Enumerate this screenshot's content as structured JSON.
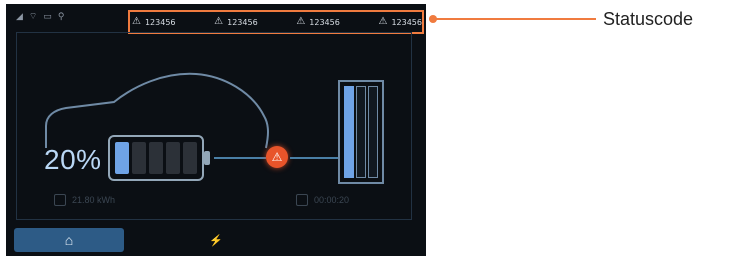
{
  "status_bar": {
    "system_icons": [
      "signal-icon",
      "wifi-icon",
      "display-icon",
      "person-icon"
    ],
    "codes": [
      {
        "icon": "warning-icon",
        "text": "123456"
      },
      {
        "icon": "warning-icon",
        "text": "123456"
      },
      {
        "icon": "warning-icon",
        "text": "123456"
      },
      {
        "icon": "warning-icon",
        "text": "123456"
      }
    ]
  },
  "main": {
    "battery_percent_label": "20%",
    "battery_level_fraction": 0.2,
    "alert_icon": "warning-icon",
    "stats": {
      "left_text": "21.80 kWh",
      "right_text": "00:00:20"
    }
  },
  "bottom_nav": {
    "home_icon": "home-icon",
    "charge_icon": "charging-icon"
  },
  "annotation": {
    "label": "Statuscode",
    "color": "#f07b3f"
  },
  "colors": {
    "screen_bg": "#0b0f14",
    "accent_blue": "#6fa3e6",
    "alert_red": "#e8542a",
    "nav_active": "#2d5b86"
  }
}
